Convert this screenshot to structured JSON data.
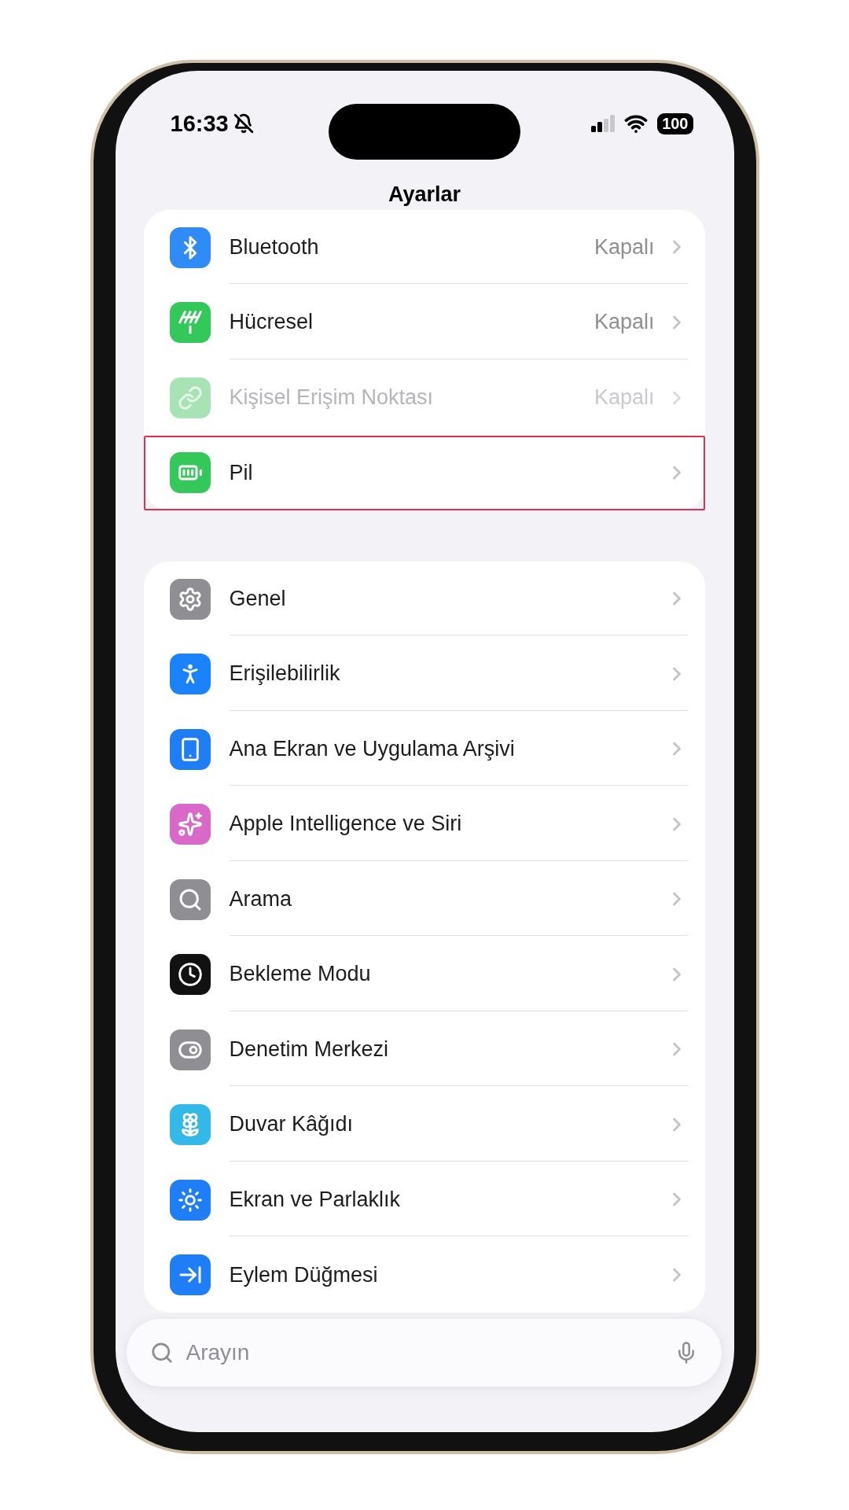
{
  "status_bar": {
    "time": "16:33",
    "silent": true,
    "battery": "100"
  },
  "title": "Ayarlar",
  "groups": [
    {
      "items": [
        {
          "label": "Bluetooth",
          "value": "Kapalı",
          "color": "#2f8cf6",
          "disabled": false,
          "highlighted": false
        },
        {
          "label": "Hücresel",
          "value": "Kapalı",
          "color": "#34c759",
          "disabled": false,
          "highlighted": false
        },
        {
          "label": "Kişisel Erişim Noktası",
          "value": "Kapalı",
          "color": "#a8e3b6",
          "disabled": true,
          "highlighted": false
        },
        {
          "label": "Pil",
          "color": "#34c759",
          "disabled": false,
          "highlighted": true
        }
      ]
    },
    {
      "items": [
        {
          "label": "Genel",
          "color": "#8e8e93",
          "disabled": false,
          "highlighted": false
        },
        {
          "label": "Erişilebilirlik",
          "color": "#1a82fb",
          "disabled": false,
          "highlighted": false
        },
        {
          "label": "Ana Ekran ve Uygulama Arşivi",
          "color": "#1f7ef5",
          "disabled": false,
          "highlighted": false
        },
        {
          "label": "Apple Intelligence ve Siri",
          "color": "#d969c9",
          "disabled": false,
          "highlighted": false
        },
        {
          "label": "Arama",
          "color": "#8e8e93",
          "disabled": false,
          "highlighted": false
        },
        {
          "label": "Bekleme Modu",
          "color": "#111111",
          "disabled": false,
          "highlighted": false
        },
        {
          "label": "Denetim Merkezi",
          "color": "#8e8e93",
          "disabled": false,
          "highlighted": false
        },
        {
          "label": "Duvar Kâğıdı",
          "color": "#33b8e8",
          "disabled": false,
          "highlighted": false
        },
        {
          "label": "Ekran ve Parlaklık",
          "color": "#1f7ef5",
          "disabled": false,
          "highlighted": false
        },
        {
          "label": "Eylem Düğmesi",
          "color": "#1f7ef5",
          "disabled": false,
          "highlighted": false
        }
      ]
    }
  ],
  "search": {
    "placeholder": "Arayın"
  }
}
